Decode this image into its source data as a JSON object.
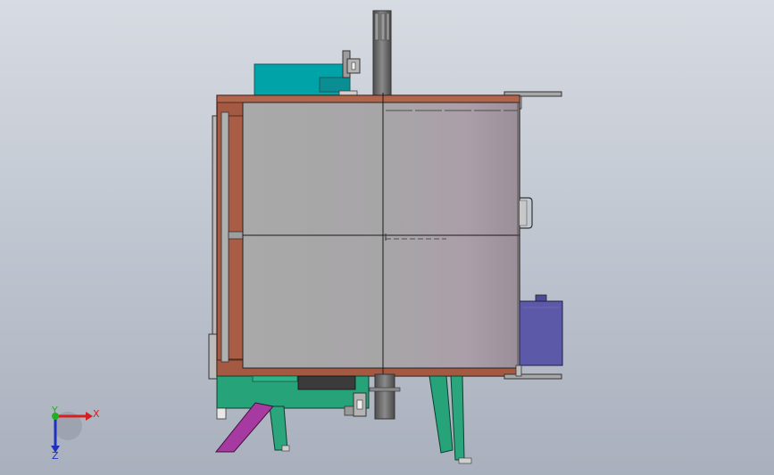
{
  "viewport": {
    "background_top": "#d7dbe2",
    "background_bottom": "#a9b0bd"
  },
  "axes": {
    "x_label": "X",
    "y_label": "Y",
    "z_label": "Z",
    "x_color": "#d42020",
    "y_color": "#20b020",
    "z_color": "#2030c0"
  },
  "colors": {
    "frame": "#a45a42",
    "panel": "#a6a6a6",
    "teal_box": "#00a3a8",
    "green_base": "#27a37a",
    "magenta_strut": "#a63aa0",
    "motor": "#5c5aa8",
    "pipe": "#6e6e6e"
  }
}
